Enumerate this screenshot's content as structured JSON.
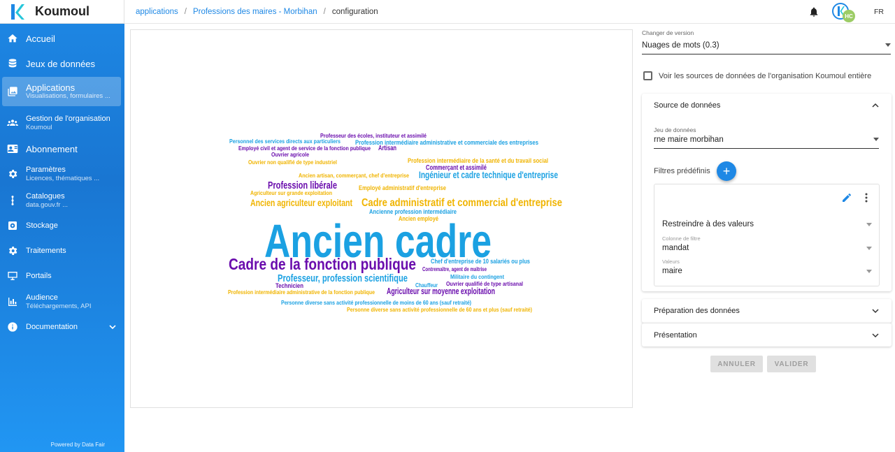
{
  "brand": {
    "name": "Koumoul"
  },
  "sidebar": {
    "items": [
      {
        "label": "Accueil",
        "sub": "",
        "icon": "home-icon"
      },
      {
        "label": "Jeux de données",
        "sub": "",
        "icon": "database-icon"
      },
      {
        "label": "Applications",
        "sub": "Visualisations, formulaires ...",
        "icon": "image-icon"
      },
      {
        "label": "Gestion de l'organisation",
        "sub": "Koumoul",
        "icon": "users-icon"
      },
      {
        "label": "Abonnement",
        "sub": "",
        "icon": "card-icon"
      },
      {
        "label": "Paramètres",
        "sub": "Licences, thématiques ...",
        "icon": "gear-icon"
      },
      {
        "label": "Catalogues",
        "sub": "data.gouv.fr ...",
        "icon": "dots-icon"
      },
      {
        "label": "Stockage",
        "sub": "",
        "icon": "storage-icon"
      },
      {
        "label": "Traitements",
        "sub": "",
        "icon": "cog-icon"
      },
      {
        "label": "Portails",
        "sub": "",
        "icon": "portal-icon"
      },
      {
        "label": "Audience",
        "sub": "Téléchargements, API",
        "icon": "chart-icon"
      },
      {
        "label": "Documentation",
        "sub": "",
        "icon": "info-icon"
      }
    ],
    "footer": "Powered by Data Fair"
  },
  "breadcrumb": {
    "items": [
      "applications",
      "Professions des maires - Morbihan",
      "configuration"
    ]
  },
  "topbar": {
    "lang": "FR",
    "avatar_initials": "HC"
  },
  "config": {
    "version_label": "Changer de version",
    "version_value": "Nuages de mots (0.3)",
    "whole_org_label": "Voir les sources de données de l'organisation Koumoul entière",
    "source": {
      "title": "Source de données",
      "dataset_label": "Jeu de données",
      "dataset_value": "rne maire morbihan",
      "filters_label": "Filtres prédéfinis",
      "filter": {
        "type_value": "Restreindre à des valeurs",
        "column_label": "Colonne de filtre",
        "column_value": "mandat",
        "values_label": "Valeurs",
        "values_value": "maire"
      }
    },
    "prep_title": "Préparation des données",
    "pres_title": "Présentation",
    "cancel_label": "ANNULER",
    "validate_label": "VALIDER"
  },
  "colors": {
    "accent": "#1e88e5",
    "cloud_blue": "#1ba1e2",
    "cloud_purple": "#6a0dad",
    "cloud_gold": "#f0b400"
  },
  "wordcloud": {
    "words": [
      {
        "text": "Professeur des écoles, instituteur et assimilé",
        "color": "purple"
      },
      {
        "text": "Personnel des services directs aux particuliers",
        "color": "blue"
      },
      {
        "text": "Profession intermédiaire administrative et commerciale des entreprises",
        "color": "blue"
      },
      {
        "text": "Employé civil et agent de service de la fonction publique",
        "color": "purple"
      },
      {
        "text": "Artisan",
        "color": "purple"
      },
      {
        "text": "Ouvrier agricole",
        "color": "purple"
      },
      {
        "text": "Profession intermédiaire de la santé et du travail social",
        "color": "gold"
      },
      {
        "text": "Ouvrier non qualifié de type industriel",
        "color": "gold"
      },
      {
        "text": "Commerçant et assimilé",
        "color": "purple"
      },
      {
        "text": "Ancien artisan, commerçant, chef d'entreprise",
        "color": "gold"
      },
      {
        "text": "Ingénieur et cadre technique d'entreprise",
        "color": "blue"
      },
      {
        "text": "Profession libérale",
        "color": "purple"
      },
      {
        "text": "Employé administratif d'entreprise",
        "color": "gold"
      },
      {
        "text": "Agriculteur sur grande exploitation",
        "color": "gold"
      },
      {
        "text": "Ancien agriculteur exploitant",
        "color": "gold"
      },
      {
        "text": "Cadre administratif et commercial d'entreprise",
        "color": "gold"
      },
      {
        "text": "Ancienne profession intermédiaire",
        "color": "blue"
      },
      {
        "text": "Ancien employé",
        "color": "gold"
      },
      {
        "text": "Ancien cadre",
        "color": "blue"
      },
      {
        "text": "Cadre de la fonction publique",
        "color": "purple"
      },
      {
        "text": "Chef d'entreprise de 10 salariés ou plus",
        "color": "blue"
      },
      {
        "text": "Contremaître, agent de maîtrise",
        "color": "purple"
      },
      {
        "text": "Professeur, profession scientifique",
        "color": "blue"
      },
      {
        "text": "Militaire du contingent",
        "color": "blue"
      },
      {
        "text": "Ouvrier qualifié de type artisanal",
        "color": "purple"
      },
      {
        "text": "Technicien",
        "color": "purple"
      },
      {
        "text": "Chauffeur",
        "color": "blue"
      },
      {
        "text": "Profession intermédiaire administrative de la fonction publique",
        "color": "gold"
      },
      {
        "text": "Agriculteur sur moyenne exploitation",
        "color": "purple"
      },
      {
        "text": "Personne diverse sans activité professionnelle de moins de 60 ans (sauf retraité)",
        "color": "blue"
      },
      {
        "text": "Personne diverse sans activité professionnelle de 60 ans et plus (sauf retraité)",
        "color": "gold"
      }
    ]
  }
}
